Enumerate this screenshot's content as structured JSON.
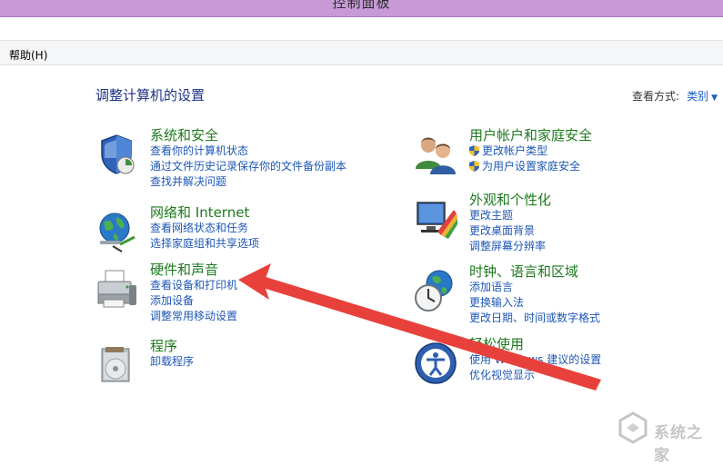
{
  "window": {
    "title": "控制面板"
  },
  "menu": {
    "help": "帮助(H)"
  },
  "page": {
    "heading": "调整计算机的设置",
    "view_by_label": "查看方式:",
    "view_by_value": "类别"
  },
  "categories": [
    {
      "icon": "security-shield-icon",
      "title": "系统和安全",
      "links": [
        "查看你的计算机状态",
        "通过文件历史记录保存你的文件备份副本",
        "查找并解决问题"
      ]
    },
    {
      "icon": "network-globe-icon",
      "title": "网络和 Internet",
      "links": [
        "查看网络状态和任务",
        "选择家庭组和共享选项"
      ]
    },
    {
      "icon": "printer-icon",
      "title": "硬件和声音",
      "links": [
        "查看设备和打印机",
        "添加设备",
        "调整常用移动设置"
      ]
    },
    {
      "icon": "programs-box-icon",
      "title": "程序",
      "links": [
        "卸载程序"
      ]
    },
    {
      "icon": "users-icon",
      "title": "用户帐户和家庭安全",
      "links": [
        "更改帐户类型",
        "为用户设置家庭安全"
      ]
    },
    {
      "icon": "display-palette-icon",
      "title": "外观和个性化",
      "links": [
        "更改主题",
        "更改桌面背景",
        "调整屏幕分辨率"
      ]
    },
    {
      "icon": "clock-globe-icon",
      "title": "时钟、语言和区域",
      "links": [
        "添加语言",
        "更换输入法",
        "更改日期、时间或数字格式"
      ]
    },
    {
      "icon": "accessibility-icon",
      "title": "轻松使用",
      "links": [
        "使用 Windows 建议的设置",
        "优化视觉显示"
      ]
    }
  ],
  "annotation": {
    "arrow_color": "#e8413b"
  },
  "watermark": {
    "text": "系统之家"
  }
}
